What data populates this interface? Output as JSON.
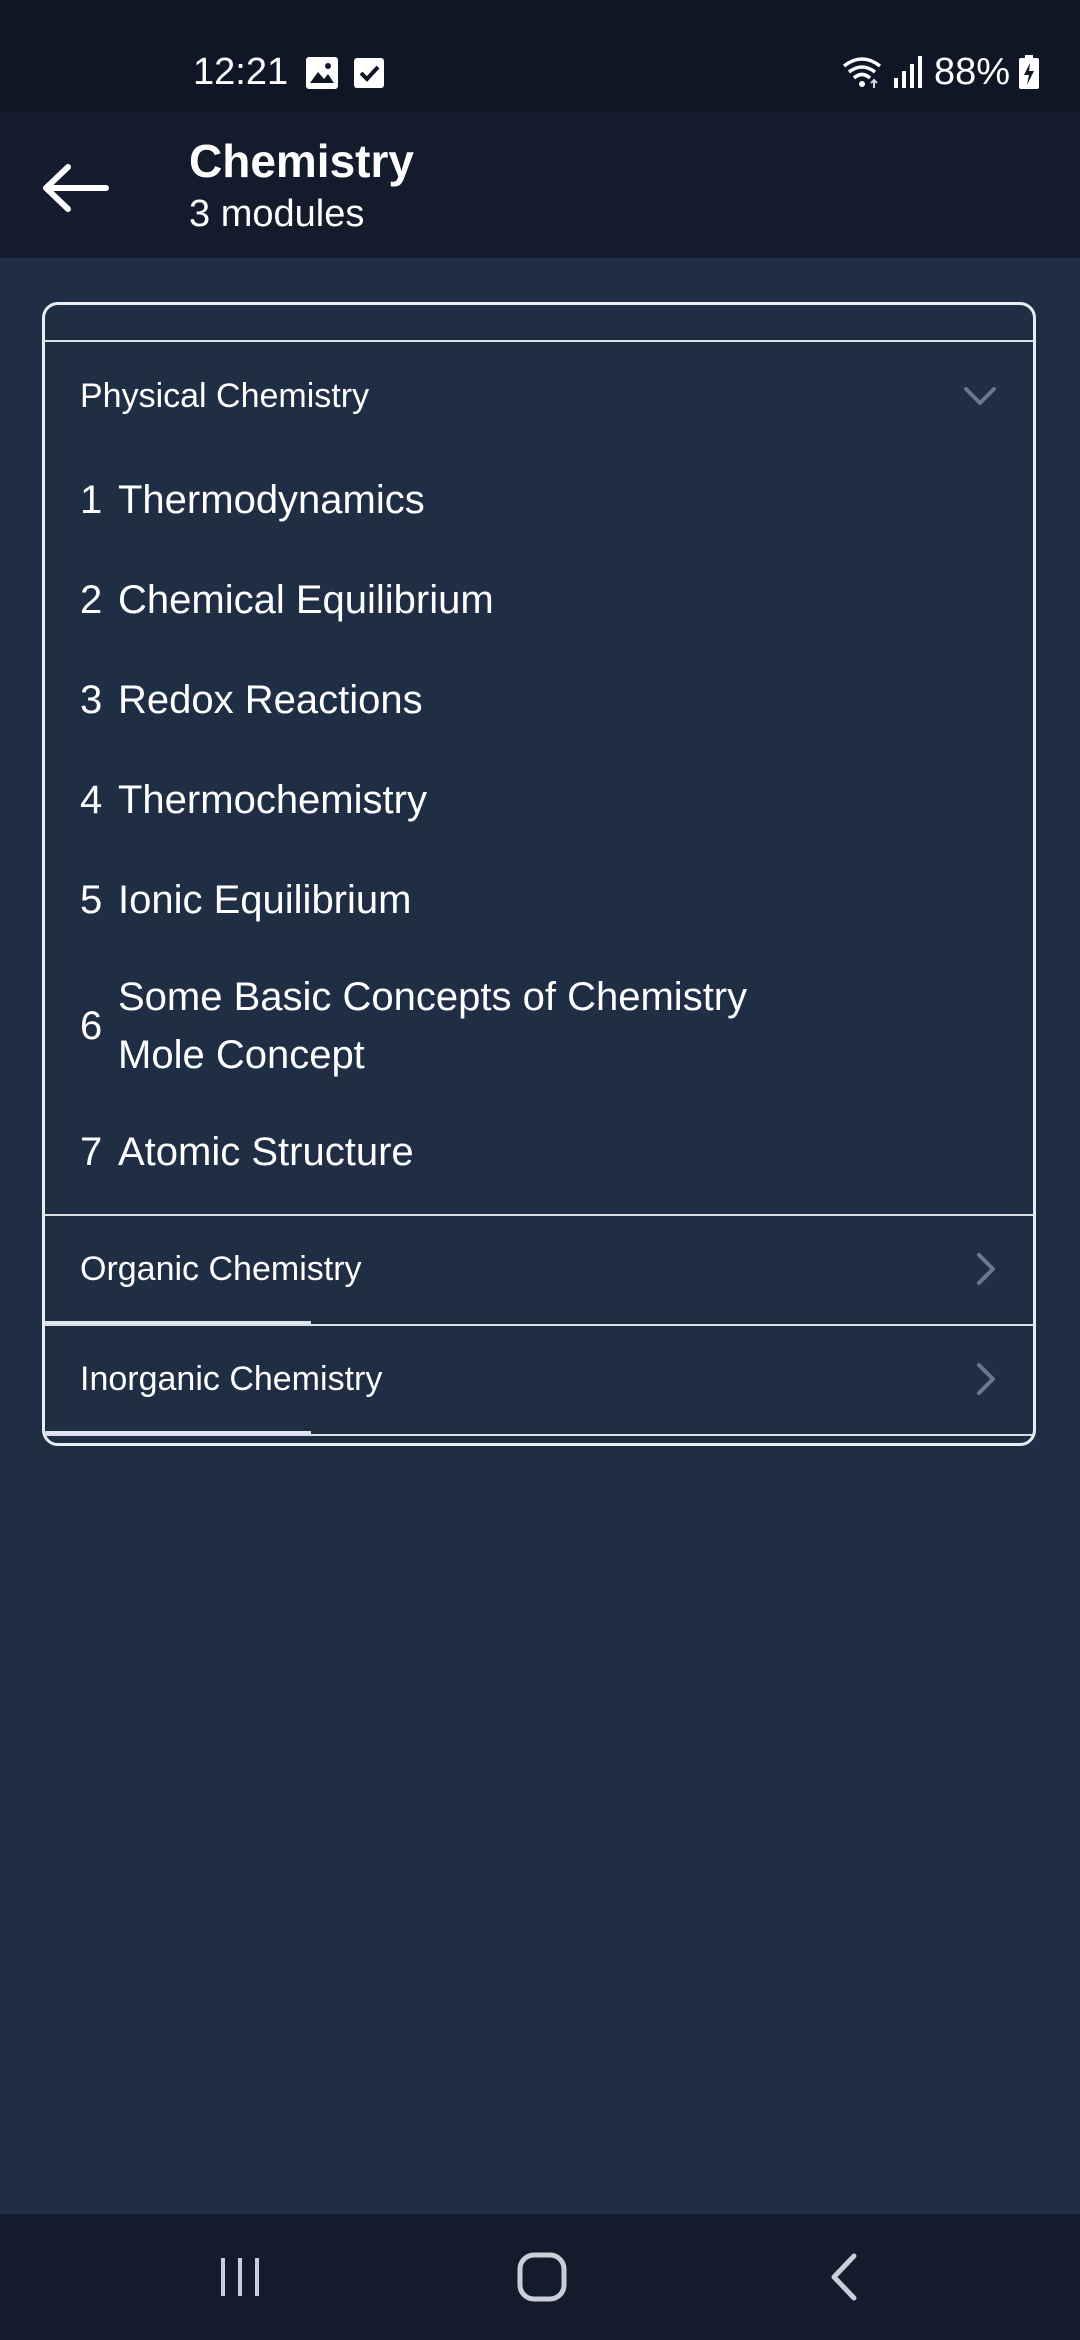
{
  "status_bar": {
    "time": "12:21",
    "battery": "88%",
    "icons": [
      "image-icon",
      "checkbox-icon",
      "wifi-icon",
      "signal-icon",
      "battery-icon"
    ]
  },
  "app_bar": {
    "title": "Chemistry",
    "subtitle": "3 modules",
    "back_icon": "arrow-left-icon"
  },
  "sections": [
    {
      "title": "Physical Chemistry",
      "expanded": true,
      "modules": [
        {
          "num": "1",
          "name": "Thermodynamics"
        },
        {
          "num": "2",
          "name": "Chemical Equilibrium"
        },
        {
          "num": "3",
          "name": "Redox Reactions"
        },
        {
          "num": "4",
          "name": "Thermochemistry"
        },
        {
          "num": "5",
          "name": "Ionic Equilibrium"
        },
        {
          "num": "6",
          "name_line1": "Some Basic Concepts of Chemistry",
          "name_line2": "Mole Concept"
        },
        {
          "num": "7",
          "name": "Atomic Structure"
        }
      ]
    },
    {
      "title": "Organic Chemistry",
      "expanded": false
    },
    {
      "title": "Inorganic Chemistry",
      "expanded": false
    }
  ],
  "colors": {
    "background": "#1f2d45",
    "status_bar": "#0f1626",
    "app_bar": "#141b2d",
    "card_border": "#e8ecf3",
    "chevron": "#6b778a"
  },
  "nav_bar": {
    "icons": [
      "recent-apps-icon",
      "home-icon",
      "back-nav-icon"
    ]
  }
}
